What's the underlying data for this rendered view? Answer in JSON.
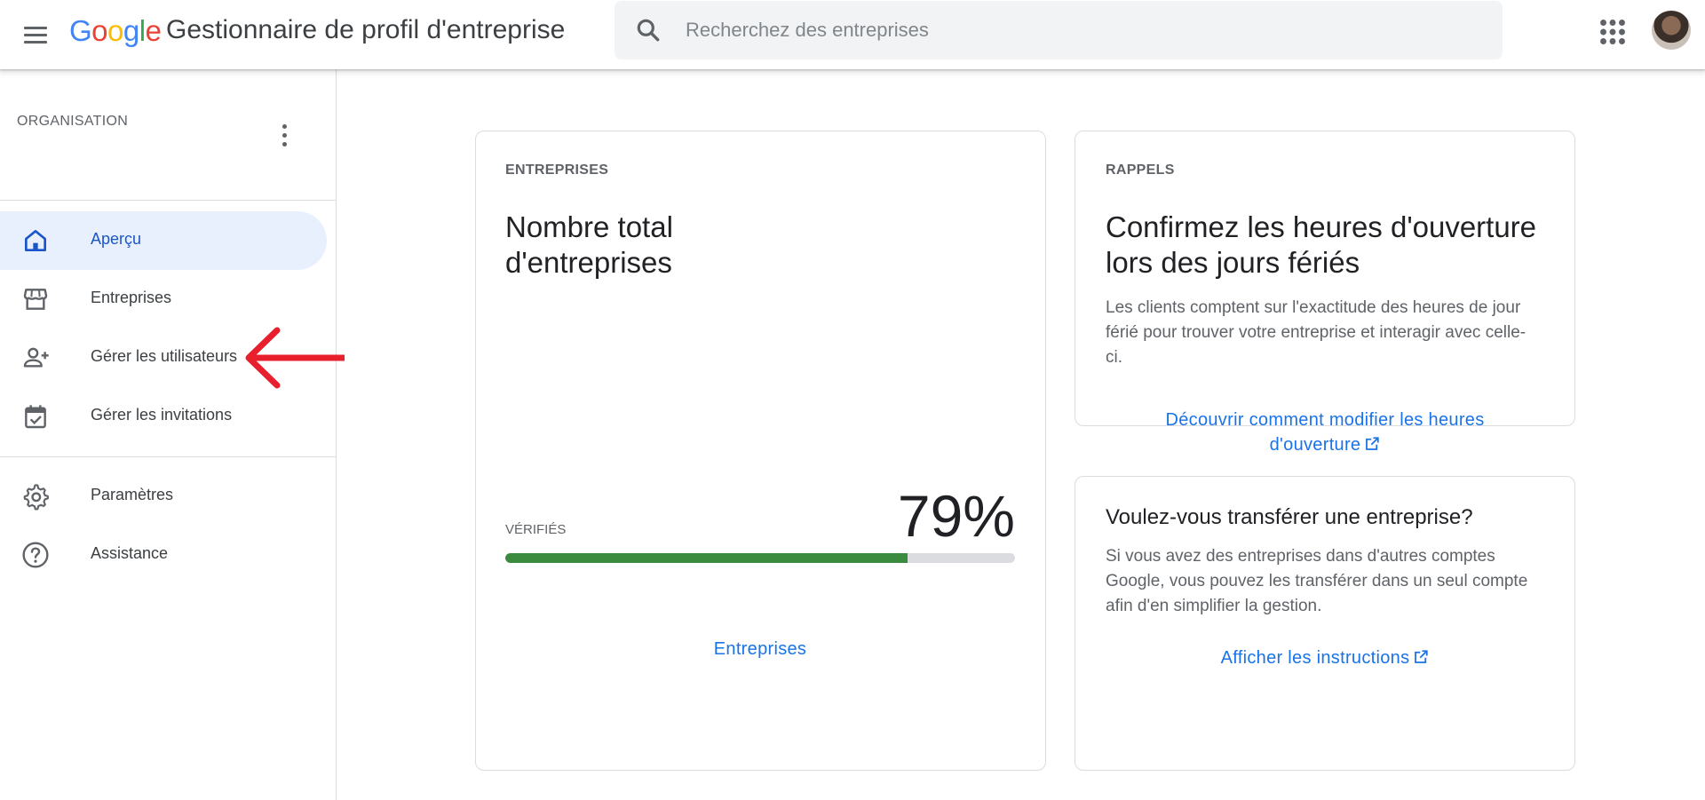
{
  "header": {
    "logo_letters": [
      "G",
      "o",
      "o",
      "g",
      "l",
      "e"
    ],
    "app_title": "Gestionnaire de profil d'entreprise",
    "search_placeholder": "Recherchez des entreprises"
  },
  "sidebar": {
    "org_label": "ORGANISATION",
    "items": [
      {
        "label": "Aperçu",
        "icon": "home-icon",
        "active": true
      },
      {
        "label": "Entreprises",
        "icon": "storefront-icon",
        "active": false
      },
      {
        "label": "Gérer les utilisateurs",
        "icon": "person-add-icon",
        "active": false
      },
      {
        "label": "Gérer les invitations",
        "icon": "event-available-icon",
        "active": false
      },
      {
        "label": "Paramètres",
        "icon": "gear-icon",
        "active": false
      },
      {
        "label": "Assistance",
        "icon": "help-icon",
        "active": false
      }
    ]
  },
  "businesses_card": {
    "eyebrow": "ENTREPRISES",
    "title_line1": "Nombre total",
    "title_line2": "d'entreprises",
    "verified_label": "VÉRIFIÉS",
    "verified_percent_text": "79%",
    "verified_fraction": 0.79,
    "link": "Entreprises"
  },
  "reminders_card": {
    "eyebrow": "RAPPELS",
    "title_line1": "Confirmez les heures d'ouverture",
    "title_line2": "lors des jours fériés",
    "body_line1": "Les clients comptent sur l'exactitude des heures de jour",
    "body_line2": "férié pour trouver votre entreprise et interagir avec celle-",
    "body_line3": "ci.",
    "link_line1": "Découvrir comment modifier les heures",
    "link_line2": "d'ouverture"
  },
  "transfer_card": {
    "title": "Voulez-vous transférer une entreprise?",
    "body_line1": "Si vous avez des entreprises dans d'autres comptes",
    "body_line2": "Google, vous pouvez les transférer dans un seul compte",
    "body_line3": "afin d'en simplifier la gestion.",
    "link": "Afficher les instructions"
  },
  "colors": {
    "accent": "#1a73e8",
    "active_nav_bg": "#e8f0fe",
    "progress_fill": "#3a8a3f",
    "annotation_arrow": "#e8202e"
  }
}
